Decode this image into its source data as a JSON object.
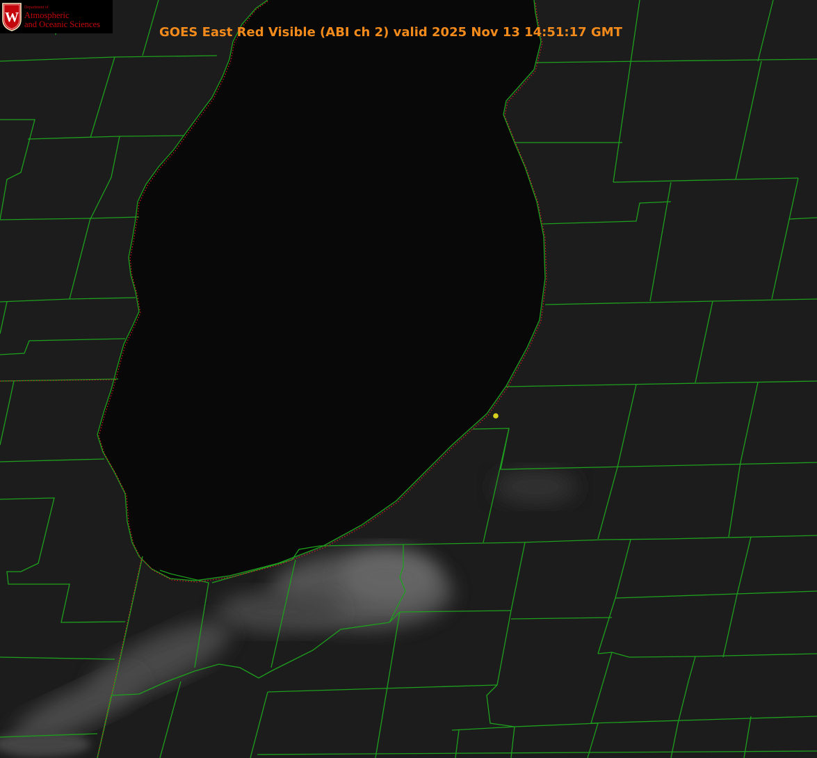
{
  "title": "GOES East Red Visible (ABI ch 2) valid 2025 Nov 13 14:51:17 GMT",
  "logo": {
    "department": "Department of",
    "line1": "Atmospheric",
    "line2": "and Oceanic Sciences",
    "crest_letter": "W"
  },
  "colors": {
    "land": "#1c1c1c",
    "water": "#080808",
    "boundary_lines": "#1ea01e",
    "shoreline_dots": "#d02020",
    "title_text": "#f28a1c",
    "logo_red": "#c5050c",
    "marker": "#d8d020"
  },
  "icons": {
    "logo": "uw-crest-icon",
    "marker": "station-dot-icon"
  }
}
